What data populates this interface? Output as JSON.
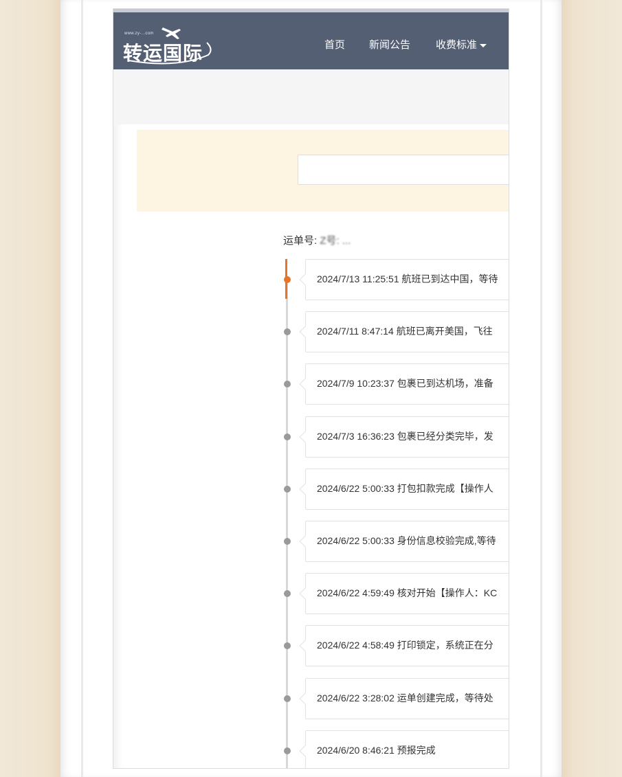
{
  "header": {
    "logo_url_text": "www.zy-...com",
    "logo_text": "转运国际",
    "nav": [
      {
        "label": "首页"
      },
      {
        "label": "新闻公告"
      },
      {
        "label": "收费标准"
      }
    ]
  },
  "search": {
    "placeholder": ""
  },
  "waybill": {
    "label": "运单号:",
    "value": "Z号: ..."
  },
  "timeline": [
    {
      "text": "2024/7/13 11:25:51 航班已到达中国，等待",
      "active": true
    },
    {
      "text": "2024/7/11 8:47:14 航班已离开美国，飞往",
      "active": false
    },
    {
      "text": "2024/7/9 10:23:37 包裹已到达机场，准备",
      "active": false
    },
    {
      "text": "2024/7/3 16:36:23 包裹已经分类完毕，发",
      "active": false
    },
    {
      "text": "2024/6/22 5:00:33 打包扣款完成【操作人",
      "active": false
    },
    {
      "text": "2024/6/22 5:00:33 身份信息校验完成,等待",
      "active": false
    },
    {
      "text": "2024/6/22 4:59:49 核对开始【操作人：KC",
      "active": false
    },
    {
      "text": "2024/6/22 4:58:49 打印锁定，系统正在分",
      "active": false
    },
    {
      "text": "2024/6/22 3:28:02 运单创建完成，等待处",
      "active": false
    },
    {
      "text": "2024/6/20 8:46:21 预报完成",
      "active": false
    }
  ],
  "colors": {
    "navbar": "#555f73",
    "accent": "#e8742a",
    "search_panel": "#fdf5e1",
    "background": "#efe6d6"
  }
}
